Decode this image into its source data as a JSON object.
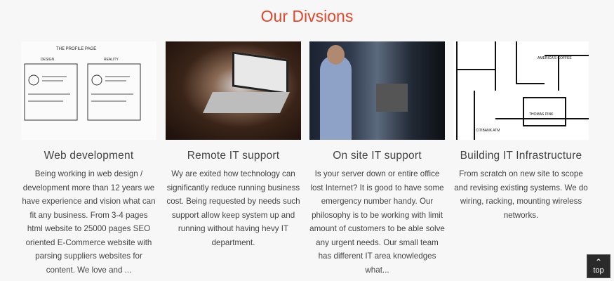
{
  "heading": "Our Divsions",
  "divisions": [
    {
      "title": "Web development",
      "text": "Being working in web design / development more than 12 years we have experience and vision what can fit any business. From 3-4 pages html website to 25000 pages SEO oriented E-Commerce website with parsing suppliers websites for content. We love and ..."
    },
    {
      "title": "Remote IT support",
      "text": "Wy are exited how technology can significantly reduce running business cost. Being requested by needs such support allow keep system up and running without having hevy IT department."
    },
    {
      "title": "On site IT support",
      "text": "Is your server down or entire office lost Internet? It is good to have some emergency number handy. Our philosophy is to be working with limit amount of customers to be able solve any urgent needs. Our small team has different IT area knowledges what..."
    },
    {
      "title": "Building IT Infrastructure",
      "text": "From scratch on new site to scope and revising existing systems. We do wiring, racking, mounting wireless networks."
    }
  ],
  "sketch_labels": {
    "page": "THE PROFILE PAGE",
    "design": "DESIGN",
    "reality": "REALITY"
  },
  "blueprint_labels": {
    "coffee": "AMERICA'S COFFEE",
    "thomas": "THOMAS PINK",
    "atm": "CITIBANK ATM"
  },
  "back_to_top": {
    "label": "top",
    "icon": "chevron-up-icon"
  },
  "colors": {
    "accent": "#e8452c",
    "background": "#f7f7f7"
  }
}
